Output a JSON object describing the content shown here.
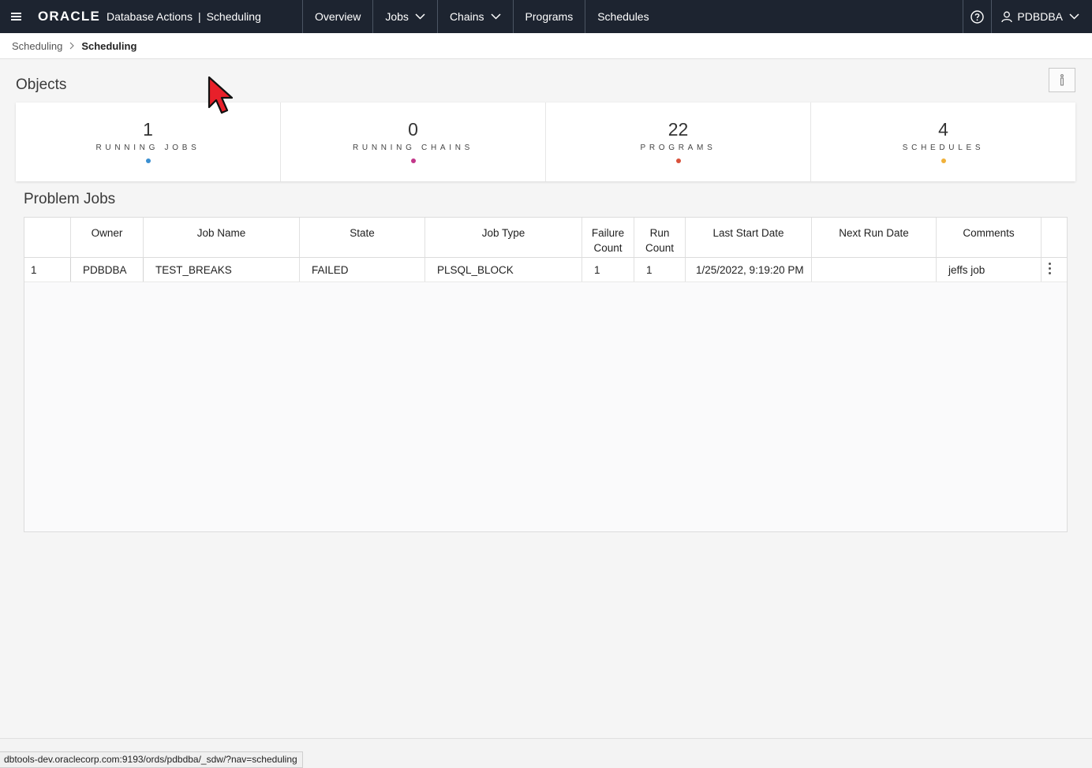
{
  "header": {
    "logo": "ORACLE",
    "product": "Database Actions",
    "separator": "|",
    "section": "Scheduling",
    "nav": [
      {
        "label": "Overview"
      },
      {
        "label": "Jobs"
      },
      {
        "label": "Chains"
      },
      {
        "label": "Programs"
      },
      {
        "label": "Schedules"
      }
    ],
    "user": "PDBDBA"
  },
  "breadcrumb": {
    "parent": "Scheduling",
    "current": "Scheduling"
  },
  "objects": {
    "title": "Objects",
    "cards": [
      {
        "value": "1",
        "label": "RUNNING JOBS",
        "dot_color": "#3a8fd1"
      },
      {
        "value": "0",
        "label": "RUNNING CHAINS",
        "dot_color": "#c2378a"
      },
      {
        "value": "22",
        "label": "PROGRAMS",
        "dot_color": "#d9513b"
      },
      {
        "value": "4",
        "label": "SCHEDULES",
        "dot_color": "#f0b13a"
      }
    ]
  },
  "problem_jobs": {
    "title": "Problem Jobs",
    "columns": [
      "",
      "Owner",
      "Job Name",
      "State",
      "Job Type",
      "Failure Count",
      "Run Count",
      "Last Start Date",
      "Next Run Date",
      "Comments",
      ""
    ],
    "rows": [
      {
        "num": "1",
        "owner": "PDBDBA",
        "job_name": "TEST_BREAKS",
        "state": "FAILED",
        "job_type": "PLSQL_BLOCK",
        "failure_count": "1",
        "run_count": "1",
        "last_start_date": "1/25/2022, 9:19:20 PM",
        "next_run_date": "",
        "comments": "jeffs job"
      }
    ]
  },
  "status_url": "dbtools-dev.oraclecorp.com:9193/ords/pdbdba/_sdw/?nav=scheduling"
}
